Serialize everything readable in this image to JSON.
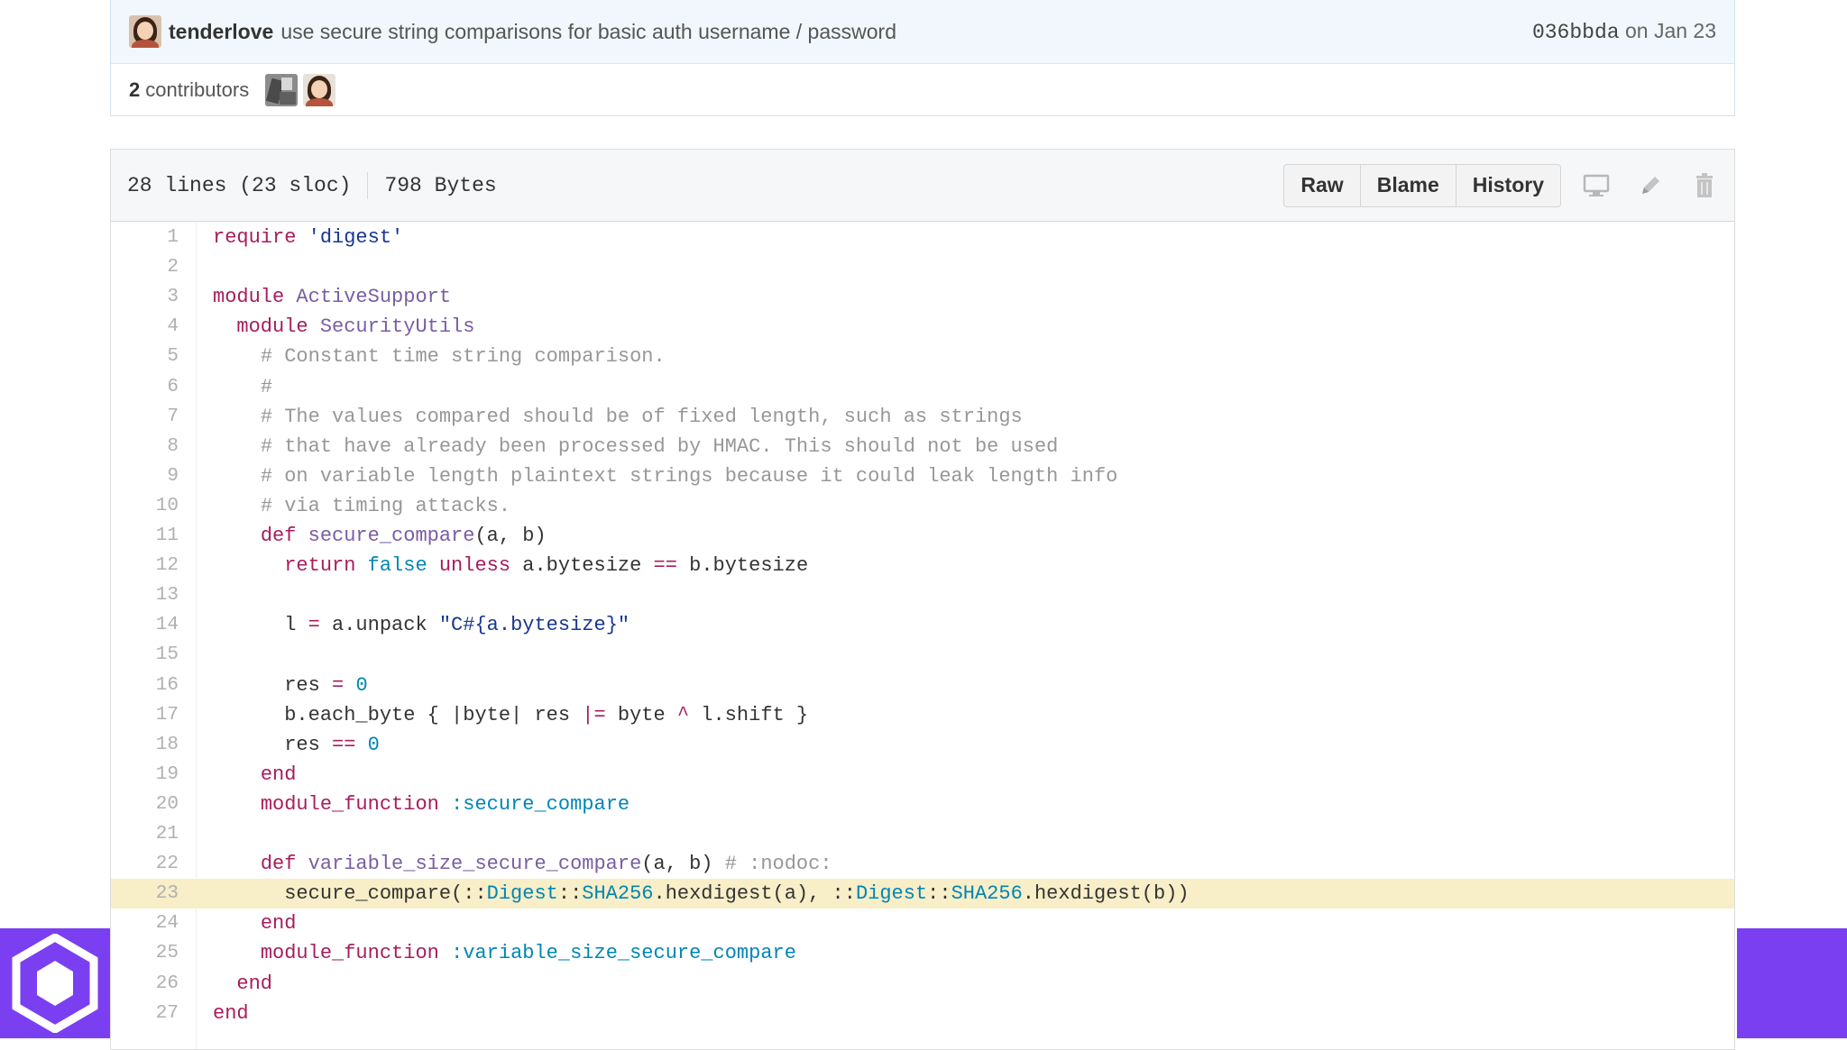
{
  "commit": {
    "author": "tenderlove",
    "message": "use secure string comparisons for basic auth username / password",
    "sha": "036bbda",
    "date_text": "on Jan 23"
  },
  "contributors": {
    "count": "2",
    "label": "contributors"
  },
  "file": {
    "lines_info": "28 lines (23 sloc)",
    "size": "798 Bytes",
    "buttons": {
      "raw": "Raw",
      "blame": "Blame",
      "history": "History"
    },
    "icons": [
      "desktop-icon",
      "pencil-icon",
      "trash-icon"
    ]
  },
  "code_lines": [
    {
      "n": "1",
      "tokens": [
        [
          "kw",
          "require"
        ],
        [
          "t",
          " "
        ],
        [
          "str",
          "'digest'"
        ]
      ]
    },
    {
      "n": "2",
      "tokens": []
    },
    {
      "n": "3",
      "tokens": [
        [
          "kw",
          "module"
        ],
        [
          "t",
          " "
        ],
        [
          "cls",
          "ActiveSupport"
        ]
      ]
    },
    {
      "n": "4",
      "tokens": [
        [
          "t",
          "  "
        ],
        [
          "kw",
          "module"
        ],
        [
          "t",
          " "
        ],
        [
          "cls",
          "SecurityUtils"
        ]
      ]
    },
    {
      "n": "5",
      "tokens": [
        [
          "t",
          "    "
        ],
        [
          "cm",
          "# Constant time string comparison."
        ]
      ]
    },
    {
      "n": "6",
      "tokens": [
        [
          "t",
          "    "
        ],
        [
          "cm",
          "#"
        ]
      ]
    },
    {
      "n": "7",
      "tokens": [
        [
          "t",
          "    "
        ],
        [
          "cm",
          "# The values compared should be of fixed length, such as strings"
        ]
      ]
    },
    {
      "n": "8",
      "tokens": [
        [
          "t",
          "    "
        ],
        [
          "cm",
          "# that have already been processed by HMAC. This should not be used"
        ]
      ]
    },
    {
      "n": "9",
      "tokens": [
        [
          "t",
          "    "
        ],
        [
          "cm",
          "# on variable length plaintext strings because it could leak length info"
        ]
      ]
    },
    {
      "n": "10",
      "tokens": [
        [
          "t",
          "    "
        ],
        [
          "cm",
          "# via timing attacks."
        ]
      ]
    },
    {
      "n": "11",
      "tokens": [
        [
          "t",
          "    "
        ],
        [
          "kw",
          "def"
        ],
        [
          "t",
          " "
        ],
        [
          "fn",
          "secure_compare"
        ],
        [
          "t",
          "(a, b)"
        ]
      ]
    },
    {
      "n": "12",
      "tokens": [
        [
          "t",
          "      "
        ],
        [
          "kw",
          "return"
        ],
        [
          "t",
          " "
        ],
        [
          "const",
          "false"
        ],
        [
          "t",
          " "
        ],
        [
          "kw",
          "unless"
        ],
        [
          "t",
          " a.bytesize "
        ],
        [
          "op",
          "=="
        ],
        [
          "t",
          " b.bytesize"
        ]
      ]
    },
    {
      "n": "13",
      "tokens": []
    },
    {
      "n": "14",
      "tokens": [
        [
          "t",
          "      l "
        ],
        [
          "op",
          "="
        ],
        [
          "t",
          " a.unpack "
        ],
        [
          "str",
          "\"C#{a.bytesize}\""
        ]
      ]
    },
    {
      "n": "15",
      "tokens": []
    },
    {
      "n": "16",
      "tokens": [
        [
          "t",
          "      res "
        ],
        [
          "op",
          "="
        ],
        [
          "t",
          " "
        ],
        [
          "const",
          "0"
        ]
      ]
    },
    {
      "n": "17",
      "tokens": [
        [
          "t",
          "      b.each_byte { |byte| res "
        ],
        [
          "op",
          "|="
        ],
        [
          "t",
          " byte "
        ],
        [
          "op",
          "^"
        ],
        [
          "t",
          " l.shift }"
        ]
      ]
    },
    {
      "n": "18",
      "tokens": [
        [
          "t",
          "      res "
        ],
        [
          "op",
          "=="
        ],
        [
          "t",
          " "
        ],
        [
          "const",
          "0"
        ]
      ]
    },
    {
      "n": "19",
      "tokens": [
        [
          "t",
          "    "
        ],
        [
          "kw",
          "end"
        ]
      ]
    },
    {
      "n": "20",
      "tokens": [
        [
          "t",
          "    "
        ],
        [
          "kw",
          "module_function"
        ],
        [
          "t",
          " "
        ],
        [
          "sym",
          ":secure_compare"
        ]
      ]
    },
    {
      "n": "21",
      "tokens": []
    },
    {
      "n": "22",
      "tokens": [
        [
          "t",
          "    "
        ],
        [
          "kw",
          "def"
        ],
        [
          "t",
          " "
        ],
        [
          "fn",
          "variable_size_secure_compare"
        ],
        [
          "t",
          "(a, b) "
        ],
        [
          "cm",
          "# :nodoc:"
        ]
      ]
    },
    {
      "n": "23",
      "highlight": true,
      "tokens": [
        [
          "t",
          "      secure_compare(::"
        ],
        [
          "const",
          "Digest"
        ],
        [
          "t",
          "::"
        ],
        [
          "const",
          "SHA256"
        ],
        [
          "t",
          ".hexdigest(a), ::"
        ],
        [
          "const",
          "Digest"
        ],
        [
          "t",
          "::"
        ],
        [
          "const",
          "SHA256"
        ],
        [
          "t",
          ".hexdigest(b))"
        ]
      ]
    },
    {
      "n": "24",
      "tokens": [
        [
          "t",
          "    "
        ],
        [
          "kw",
          "end"
        ]
      ]
    },
    {
      "n": "25",
      "tokens": [
        [
          "t",
          "    "
        ],
        [
          "kw",
          "module_function"
        ],
        [
          "t",
          " "
        ],
        [
          "sym",
          ":variable_size_secure_compare"
        ]
      ]
    },
    {
      "n": "26",
      "tokens": [
        [
          "t",
          "  "
        ],
        [
          "kw",
          "end"
        ]
      ]
    },
    {
      "n": "27",
      "tokens": [
        [
          "kw",
          "end"
        ]
      ]
    }
  ],
  "colors": {
    "keyword": "#a71d5d",
    "string": "#183691",
    "class": "#795da3",
    "comment": "#969896",
    "constant": "#0086b3",
    "highlight": "#f8eec7",
    "brand": "#7b3ff2"
  },
  "overlay": {
    "badge_icon": "hexagon-logo-icon"
  }
}
